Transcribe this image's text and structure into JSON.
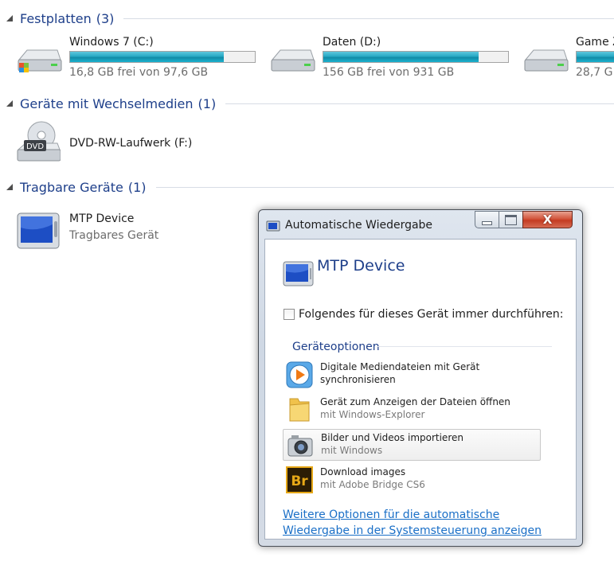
{
  "groups": {
    "hard_disks": {
      "title": "Festplatten",
      "count": "(3)"
    },
    "removable": {
      "title": "Geräte mit Wechselmedien",
      "count": "(1)"
    },
    "portable": {
      "title": "Tragbare Geräte",
      "count": "(1)"
    }
  },
  "drives": [
    {
      "name": "Windows 7 (C:)",
      "free": "16,8 GB frei von 97,6 GB",
      "used_fraction": 0.83
    },
    {
      "name": "Daten (D:)",
      "free": "156 GB frei von 931 GB",
      "used_fraction": 0.84
    },
    {
      "name": "Game Z",
      "free": "28,7 G",
      "used_fraction": 0.9
    }
  ],
  "removable_devices": [
    {
      "name": "DVD-RW-Laufwerk (F:)",
      "icon_label": "DVD"
    }
  ],
  "portable_devices": [
    {
      "name": "MTP Device",
      "subtitle": "Tragbares Gerät"
    }
  ],
  "dialog": {
    "title": "Automatische Wiedergabe",
    "close_glyph": "X",
    "device_name": "MTP Device",
    "always_do_label": "Folgendes für dieses Gerät immer durchführen:",
    "always_do_checked": false,
    "section_label": "Geräteoptionen",
    "options": [
      {
        "line1": "Digitale Mediendateien mit Gerät",
        "line2": "synchronisieren",
        "icon": "media-sync-icon"
      },
      {
        "line1": "Gerät zum Anzeigen der Dateien öffnen",
        "line2": "mit Windows-Explorer",
        "icon": "folder-icon"
      },
      {
        "line1": "Bilder und Videos importieren",
        "line2": "mit Windows",
        "icon": "camera-icon"
      },
      {
        "line1": "Download images",
        "line2": "mit Adobe Bridge CS6",
        "icon": "adobe-bridge-icon",
        "icon_text": "Br"
      }
    ],
    "more_options_link": "Weitere Optionen für die automatische Wiedergabe in der Systemsteuerung anzeigen"
  },
  "colors": {
    "group_header": "#1e3f8a",
    "link": "#1a6fc7",
    "bar_fill": "#27a9c4",
    "close_button": "#c43b22"
  }
}
